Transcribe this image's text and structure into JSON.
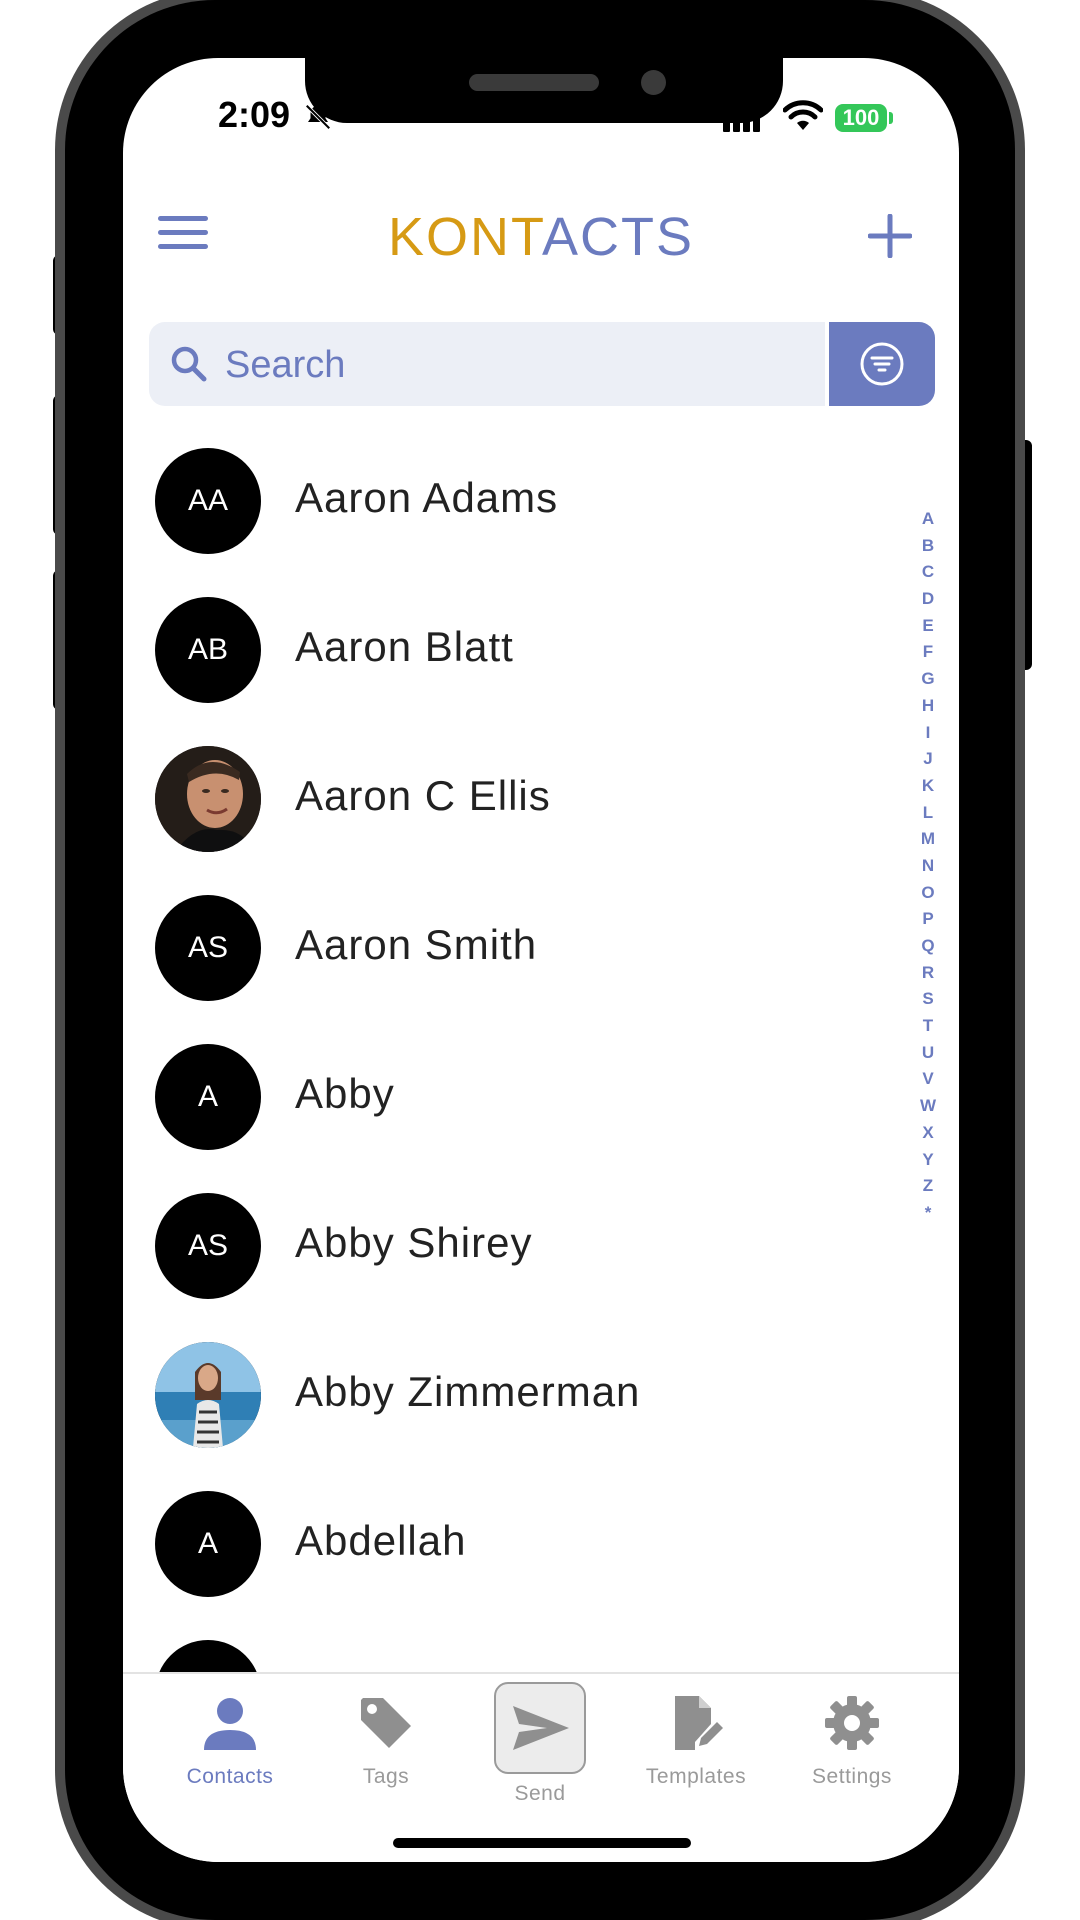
{
  "status_bar": {
    "time": "2:09",
    "battery": "100"
  },
  "header": {
    "brand_part1": "KONT",
    "brand_part2": "ACTS"
  },
  "search": {
    "placeholder": "Search",
    "value": ""
  },
  "contacts": [
    {
      "initials": "AA",
      "name": "Aaron Adams",
      "photo": false
    },
    {
      "initials": "AB",
      "name": "Aaron Blatt",
      "photo": false
    },
    {
      "initials": "",
      "name": "Aaron C Ellis",
      "photo": true
    },
    {
      "initials": "AS",
      "name": "Aaron Smith",
      "photo": false
    },
    {
      "initials": "A",
      "name": "Abby",
      "photo": false
    },
    {
      "initials": "AS",
      "name": "Abby Shirey",
      "photo": false
    },
    {
      "initials": "",
      "name": "Abby Zimmerman",
      "photo": true
    },
    {
      "initials": "A",
      "name": "Abdellah",
      "photo": false
    }
  ],
  "alpha_index": [
    "A",
    "B",
    "C",
    "D",
    "E",
    "F",
    "G",
    "H",
    "I",
    "J",
    "K",
    "L",
    "M",
    "N",
    "O",
    "P",
    "Q",
    "R",
    "S",
    "T",
    "U",
    "V",
    "W",
    "X",
    "Y",
    "Z",
    "*"
  ],
  "tabs": [
    {
      "label": "Contacts",
      "icon": "person-icon",
      "active": true
    },
    {
      "label": "Tags",
      "icon": "tag-icon",
      "active": false
    },
    {
      "label": "Send",
      "icon": "send-icon",
      "active": false
    },
    {
      "label": "Templates",
      "icon": "template-edit-icon",
      "active": false
    },
    {
      "label": "Settings",
      "icon": "gear-icon",
      "active": false
    }
  ],
  "colors": {
    "accent": "#6b7bbf",
    "brand_orange": "#d69a14",
    "battery": "#34c759"
  }
}
